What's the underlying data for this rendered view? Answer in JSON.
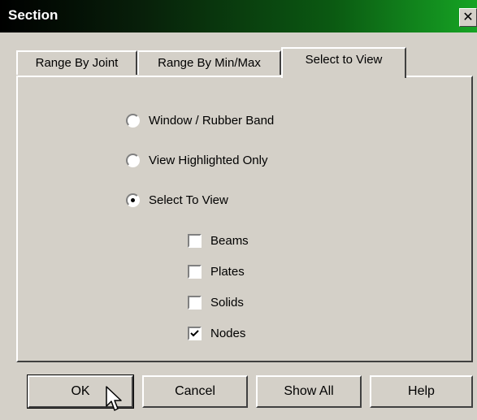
{
  "window": {
    "title": "Section",
    "close_glyph": "✕"
  },
  "tabs": [
    {
      "label": "Range By Joint",
      "active": false
    },
    {
      "label": "Range By Min/Max",
      "active": false
    },
    {
      "label": "Select to View",
      "active": true
    }
  ],
  "options": {
    "radios": [
      {
        "label": "Window / Rubber Band",
        "selected": false
      },
      {
        "label": "View Highlighted Only",
        "selected": false
      },
      {
        "label": "Select To View",
        "selected": true
      }
    ],
    "checkboxes": [
      {
        "label": "Beams",
        "checked": false
      },
      {
        "label": "Plates",
        "checked": false
      },
      {
        "label": "Solids",
        "checked": false
      },
      {
        "label": "Nodes",
        "checked": true
      }
    ]
  },
  "buttons": {
    "ok": "OK",
    "cancel": "Cancel",
    "show_all": "Show All",
    "help": "Help"
  },
  "colors": {
    "face": "#d4d0c8",
    "title_start": "#000000",
    "title_end": "#16a424"
  }
}
